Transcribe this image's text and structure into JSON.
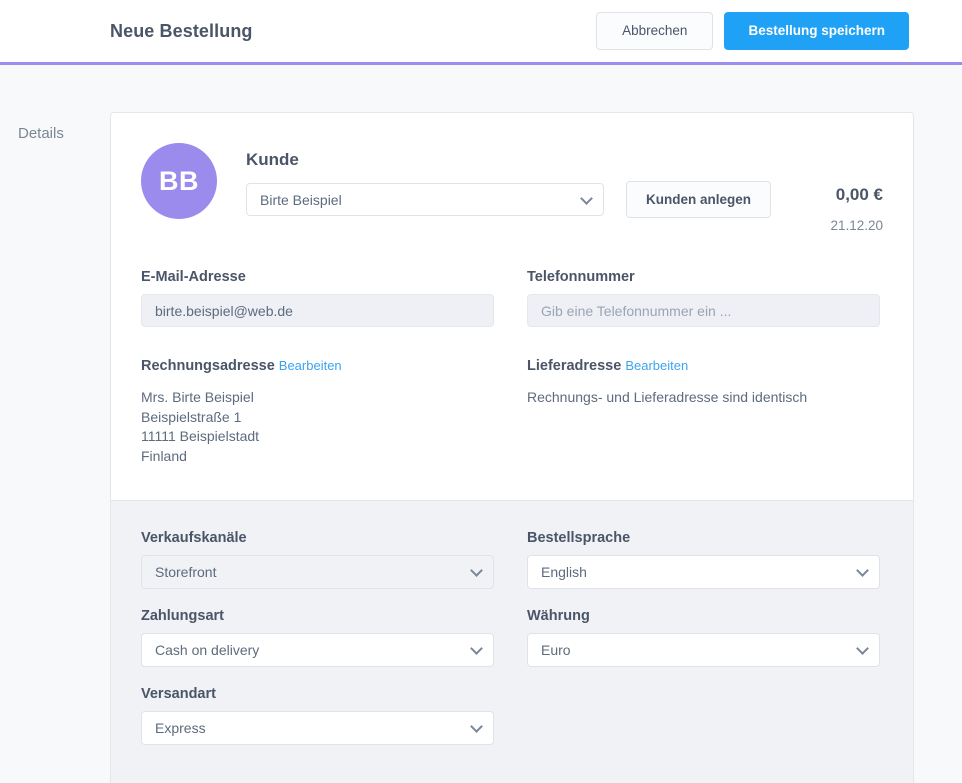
{
  "header": {
    "title": "Neue Bestellung",
    "cancel_label": "Abbrechen",
    "save_label": "Bestellung speichern",
    "accent_color": "#9d8df1",
    "primary_color": "#1fa2f6"
  },
  "sidebar": {
    "section_label": "Details"
  },
  "customer": {
    "avatar_initials": "BB",
    "avatar_color": "#9b8bec",
    "heading": "Kunde",
    "select_value": "Birte Beispiel",
    "create_customer_label": "Kunden anlegen",
    "total_amount": "0,00 €",
    "order_date": "21.12.20"
  },
  "contact": {
    "email_label": "E-Mail-Adresse",
    "email_value": "birte.beispiel@web.de",
    "phone_label": "Telefonnummer",
    "phone_placeholder": "Gib eine Telefonnummer ein ..."
  },
  "billing_address": {
    "label": "Rechnungsadresse",
    "edit_label": "Bearbeiten",
    "lines": "Mrs. Birte Beispiel\nBeispielstraße 1\n11111 Beispielstadt\nFinland"
  },
  "shipping_address": {
    "label": "Lieferadresse",
    "edit_label": "Bearbeiten",
    "note": "Rechnungs- und Lieferadresse sind identisch"
  },
  "settings": {
    "sales_channel": {
      "label": "Verkaufskanäle",
      "value": "Storefront"
    },
    "payment_method": {
      "label": "Zahlungsart",
      "value": "Cash on delivery"
    },
    "shipping_method": {
      "label": "Versandart",
      "value": "Express"
    },
    "order_language": {
      "label": "Bestellsprache",
      "value": "English"
    },
    "currency": {
      "label": "Währung",
      "value": "Euro"
    }
  }
}
